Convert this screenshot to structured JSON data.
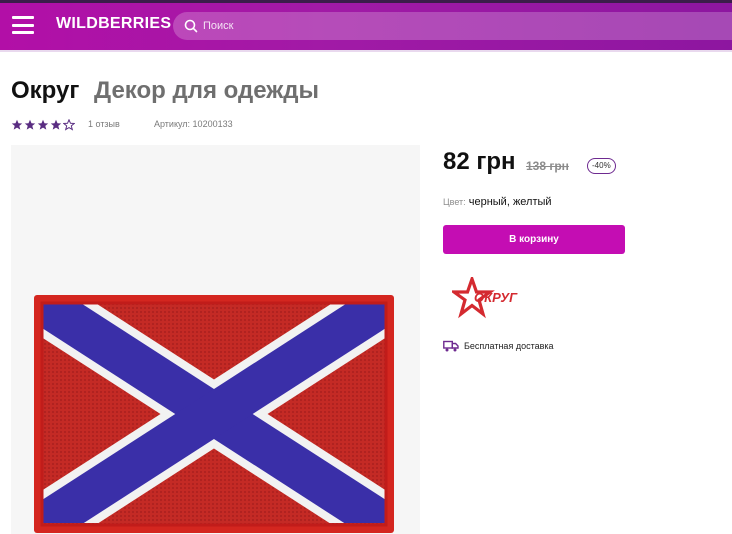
{
  "header": {
    "brand": "WILDBERRIES",
    "search_placeholder": "Поиск",
    "menu_icon": "hamburger-icon",
    "search_icon": "search-icon",
    "colors": {
      "gradient_start": "#b20fa7",
      "gradient_end": "#8d16a0"
    }
  },
  "product": {
    "brand": "Округ",
    "name": "Декор для одежды",
    "rating": 4,
    "rating_max": 5,
    "reviews": "1 отзыв",
    "article": "Артикул: 10200133",
    "price": "82 грн",
    "old_price": "138 грн",
    "discount": "-40%",
    "color_label": "Цвет:",
    "color_value": "черный, желтый",
    "cart_button": "В корзину",
    "brand_logo_text": "ОКРУГ",
    "delivery": "Бесплатная доставка",
    "accent_color": "#c40db3"
  }
}
